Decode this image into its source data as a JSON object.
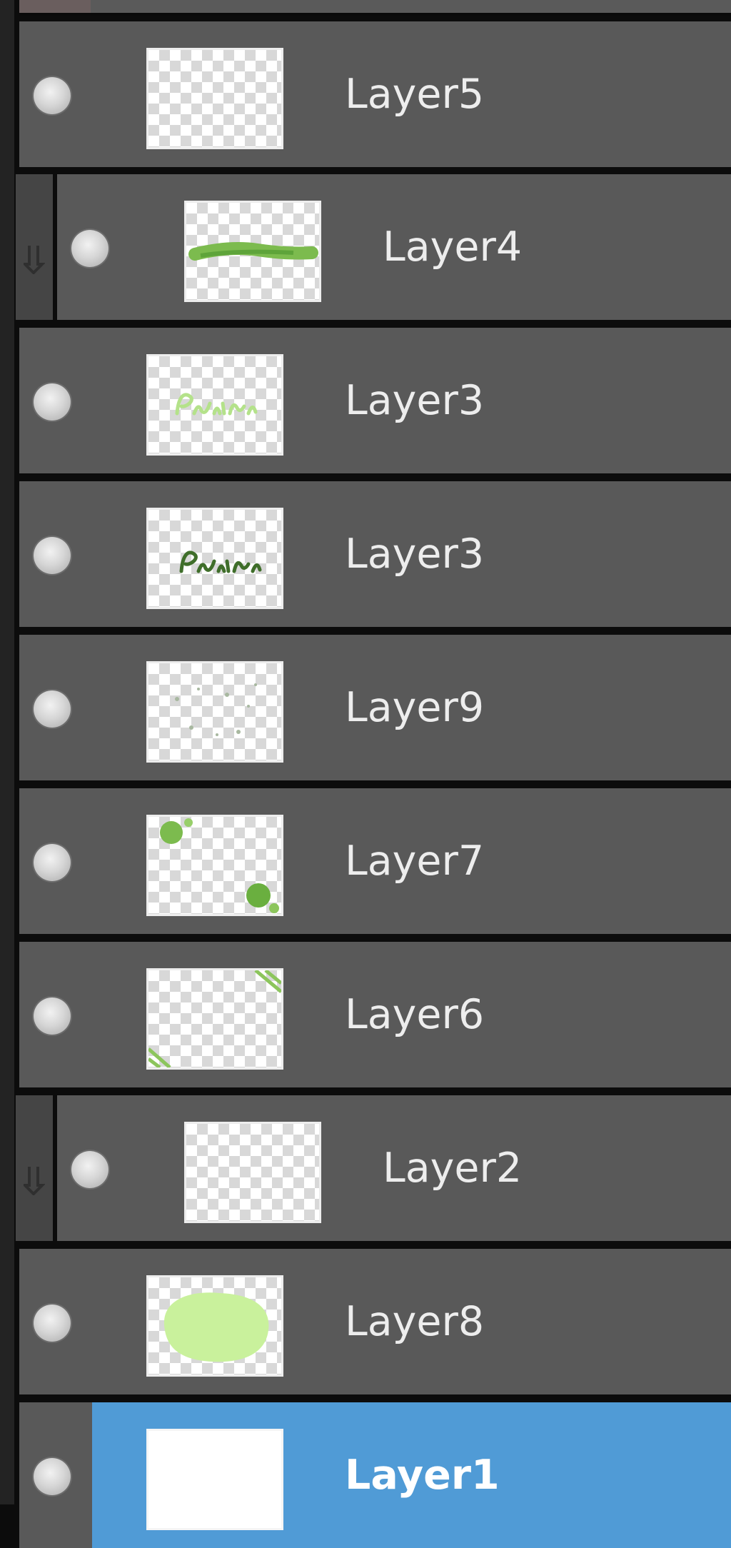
{
  "layers_panel": {
    "layers": [
      {
        "name": "Layer5",
        "thumbnail": "empty-transparent",
        "clipped": false,
        "selected": false
      },
      {
        "name": "Layer4",
        "thumbnail": "green-brush-stroke",
        "clipped": true,
        "selected": false
      },
      {
        "name": "Layer3",
        "thumbnail": "light-green-script-text",
        "clipped": false,
        "selected": false
      },
      {
        "name": "Layer3",
        "thumbnail": "dark-green-script-text",
        "clipped": false,
        "selected": false
      },
      {
        "name": "Layer9",
        "thumbnail": "faint-specks",
        "clipped": false,
        "selected": false
      },
      {
        "name": "Layer7",
        "thumbnail": "green-corner-dots",
        "clipped": false,
        "selected": false
      },
      {
        "name": "Layer6",
        "thumbnail": "green-corner-stripes",
        "clipped": false,
        "selected": false
      },
      {
        "name": "Layer2",
        "thumbnail": "empty-transparent",
        "clipped": true,
        "selected": false
      },
      {
        "name": "Layer8",
        "thumbnail": "light-green-blob",
        "clipped": false,
        "selected": false
      },
      {
        "name": "Layer1",
        "thumbnail": "white-fill",
        "clipped": false,
        "selected": true
      }
    ],
    "colors": {
      "row_bg": "#595959",
      "selected_bg": "#509bd6",
      "clip_marker": "#454545",
      "separator": "#0c0c0c"
    }
  }
}
